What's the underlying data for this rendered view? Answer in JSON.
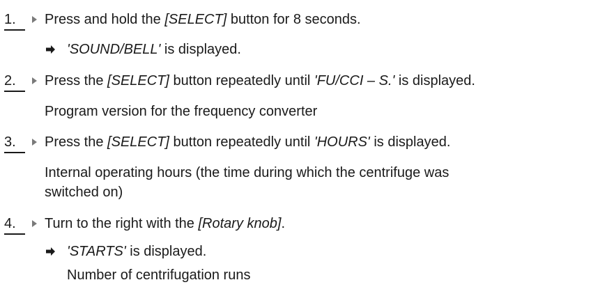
{
  "steps": [
    {
      "number": "1.",
      "parts": [
        "Press and hold the ",
        "[SELECT]",
        " button for 8 seconds."
      ],
      "result": "'SOUND/BELL'",
      "result_suffix": " is displayed."
    },
    {
      "number": "2.",
      "parts": [
        "Press the ",
        "[SELECT]",
        " button repeatedly until ",
        "'FU/CCI – S.'",
        " is displayed."
      ],
      "note": "Program version for the frequency converter"
    },
    {
      "number": "3.",
      "parts": [
        "Press the ",
        "[SELECT]",
        " button repeatedly until ",
        "'HOURS'",
        " is displayed."
      ],
      "note_line1": "Internal operating hours (the time during which the centrifuge was",
      "note_line2": "switched on)"
    },
    {
      "number": "4.",
      "parts": [
        "Turn to the right with the ",
        "[Rotary knob]",
        "."
      ],
      "result": "'STARTS'",
      "result_suffix": " is displayed.",
      "note": "Number of centrifugation runs"
    }
  ]
}
